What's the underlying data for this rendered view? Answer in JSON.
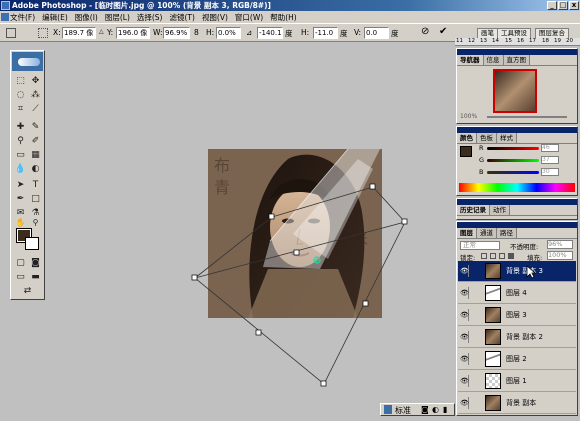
{
  "window": {
    "title": "Adobe Photoshop - [临时图片.jpg @ 100% (背景 副本 3, RGB/8#)]",
    "controls": [
      "_",
      "□",
      "x"
    ]
  },
  "menu": {
    "items": [
      "文件(F)",
      "编辑(E)",
      "图像(I)",
      "图层(L)",
      "选择(S)",
      "滤镜(T)",
      "视图(V)",
      "窗口(W)",
      "帮助(H)"
    ]
  },
  "options": {
    "x_label": "X:",
    "x_value": "189.7 像",
    "y_label": "Y:",
    "y_value": "196.0 像",
    "w_label": "W:",
    "w_value": "96.9%",
    "h_label": "H:",
    "h_value": "0.0%",
    "angle_value": "-140.1",
    "angle_unit": "度",
    "hskew_label": "H:",
    "hskew_value": "-11.0",
    "hskew_unit": "度",
    "vskew_label": "V:",
    "vskew_value": "0.0",
    "vskew_unit": "度",
    "palette_tabs": [
      "画笔",
      "工具预设",
      "图层复合"
    ]
  },
  "ruler": {
    "ticks": [
      "11",
      "12",
      "13",
      "14",
      "15",
      "16",
      "17",
      "18",
      "19",
      "20"
    ]
  },
  "navigator": {
    "tabs": [
      "导航器",
      "信息",
      "直方图"
    ],
    "zoom": "100%"
  },
  "color_palette": {
    "tabs": [
      "颜色",
      "色板",
      "样式"
    ],
    "channels": [
      {
        "label": "R",
        "value": "46"
      },
      {
        "label": "G",
        "value": "37"
      },
      {
        "label": "B",
        "value": "30"
      }
    ]
  },
  "history_palette": {
    "tabs": [
      "历史记录",
      "动作"
    ]
  },
  "layers_palette": {
    "tabs": [
      "图层",
      "通道",
      "路径"
    ],
    "blend_mode": "正常",
    "opacity_label": "不透明度:",
    "opacity_value": "96%",
    "lock_label": "锁定:",
    "fill_label": "填充:",
    "fill_value": "100%",
    "layers": [
      {
        "name": "背景 副本 3",
        "thumb": "photo",
        "active": true
      },
      {
        "name": "图层 4",
        "thumb": "shard",
        "active": false
      },
      {
        "name": "图层 3",
        "thumb": "photo",
        "active": false
      },
      {
        "name": "背景 副本 2",
        "thumb": "photo",
        "active": false
      },
      {
        "name": "图层 2",
        "thumb": "shard",
        "active": false
      },
      {
        "name": "图层 1",
        "thumb": "trans",
        "active": false
      },
      {
        "name": "背景 副本",
        "thumb": "photo",
        "active": false
      }
    ]
  },
  "status_bar": {
    "label": "标准"
  },
  "colors": {
    "title_bar": "#0a246a",
    "foreground_swatch": "#3b2c1e",
    "background_swatch": "#ffffff",
    "chrome": "#d4d0c8"
  }
}
